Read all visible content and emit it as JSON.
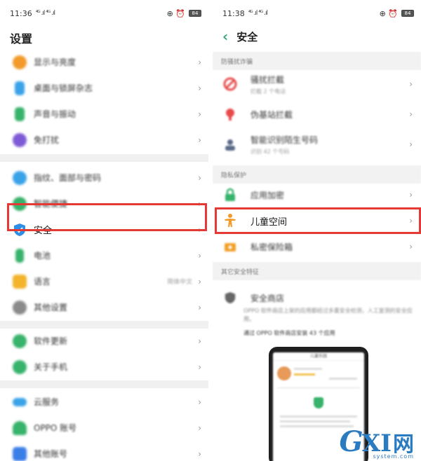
{
  "left": {
    "status": {
      "time": "11:36",
      "signal": "⁴ᴳ .ıl ⁴ᴳ .ıl",
      "battery": "84"
    },
    "title": "设置",
    "rows": [
      {
        "label": "显示与亮度",
        "icon": "brightness-icon",
        "color": "#f39a2b"
      },
      {
        "label": "桌面与锁屏杂志",
        "icon": "wallpaper-icon",
        "color": "#3aa3e8"
      },
      {
        "label": "声音与振动",
        "icon": "sound-icon",
        "color": "#37b36b"
      },
      {
        "label": "免打扰",
        "icon": "moon-icon",
        "color": "#7e5bd6"
      },
      {
        "label": "指纹、面部与密码",
        "icon": "fingerprint-icon",
        "color": "#3aa3e8"
      },
      {
        "label": "智能便捷",
        "icon": "smart-icon",
        "color": "#37b36b"
      },
      {
        "label": "安全",
        "icon": "shield-icon",
        "color": "#2f8fe6"
      },
      {
        "label": "电池",
        "icon": "battery-icon",
        "color": "#37b36b"
      },
      {
        "label": "语言",
        "icon": "language-icon",
        "color": "#f3b32b",
        "value": "简体中文"
      },
      {
        "label": "其他设置",
        "icon": "gear-icon",
        "color": "#8a8a8a"
      },
      {
        "label": "软件更新",
        "icon": "update-icon",
        "color": "#37b36b"
      },
      {
        "label": "关于手机",
        "icon": "info-icon",
        "color": "#37b36b"
      },
      {
        "label": "云服务",
        "icon": "cloud-icon",
        "color": "#3aa3e8"
      },
      {
        "label": "OPPO 账号",
        "icon": "account-icon",
        "color": "#37b36b"
      },
      {
        "label": "其他账号",
        "icon": "key-icon",
        "color": "#3a7fe8"
      }
    ]
  },
  "right": {
    "status": {
      "time": "11:38",
      "signal": "⁴ᴳ .ıl ⁴ᴳ .ıl",
      "battery": "84"
    },
    "title": "安全",
    "sections": {
      "fraud": "防骚扰诈骗",
      "privacy": "隐私保护",
      "other": "其它安全特征"
    },
    "rows": [
      {
        "label": "骚扰拦截",
        "sub": "拦截 2 个电话",
        "icon": "block-icon",
        "color": "#e84a4a"
      },
      {
        "label": "伪基站拦截",
        "sub": "",
        "icon": "tower-icon",
        "color": "#e84a4a"
      },
      {
        "label": "智能识别陌生号码",
        "sub": "识别 42 个号码",
        "icon": "person-icon",
        "color": "#5a6a88"
      },
      {
        "label": "应用加密",
        "sub": "",
        "icon": "lock-icon",
        "color": "#37b36b"
      },
      {
        "label": "儿童空间",
        "sub": "",
        "icon": "child-icon",
        "color": "#f39a2b"
      },
      {
        "label": "私密保险箱",
        "sub": "",
        "icon": "safe-icon",
        "color": "#f3a02b"
      }
    ],
    "store": {
      "label": "安全商店",
      "desc": "OPPO 软件商店上架的应用都经过多重安全检测，人工复测的安全应用。",
      "link": "通过 OPPO 软件商店安装 43 个应用",
      "phone_title": "儿童乐园"
    }
  },
  "watermark": {
    "g": "G",
    "xi": "XI",
    "cn": "网",
    "sub": "system.com"
  },
  "colors": {
    "accent": "#3aa67a",
    "highlight": "#e53935"
  }
}
